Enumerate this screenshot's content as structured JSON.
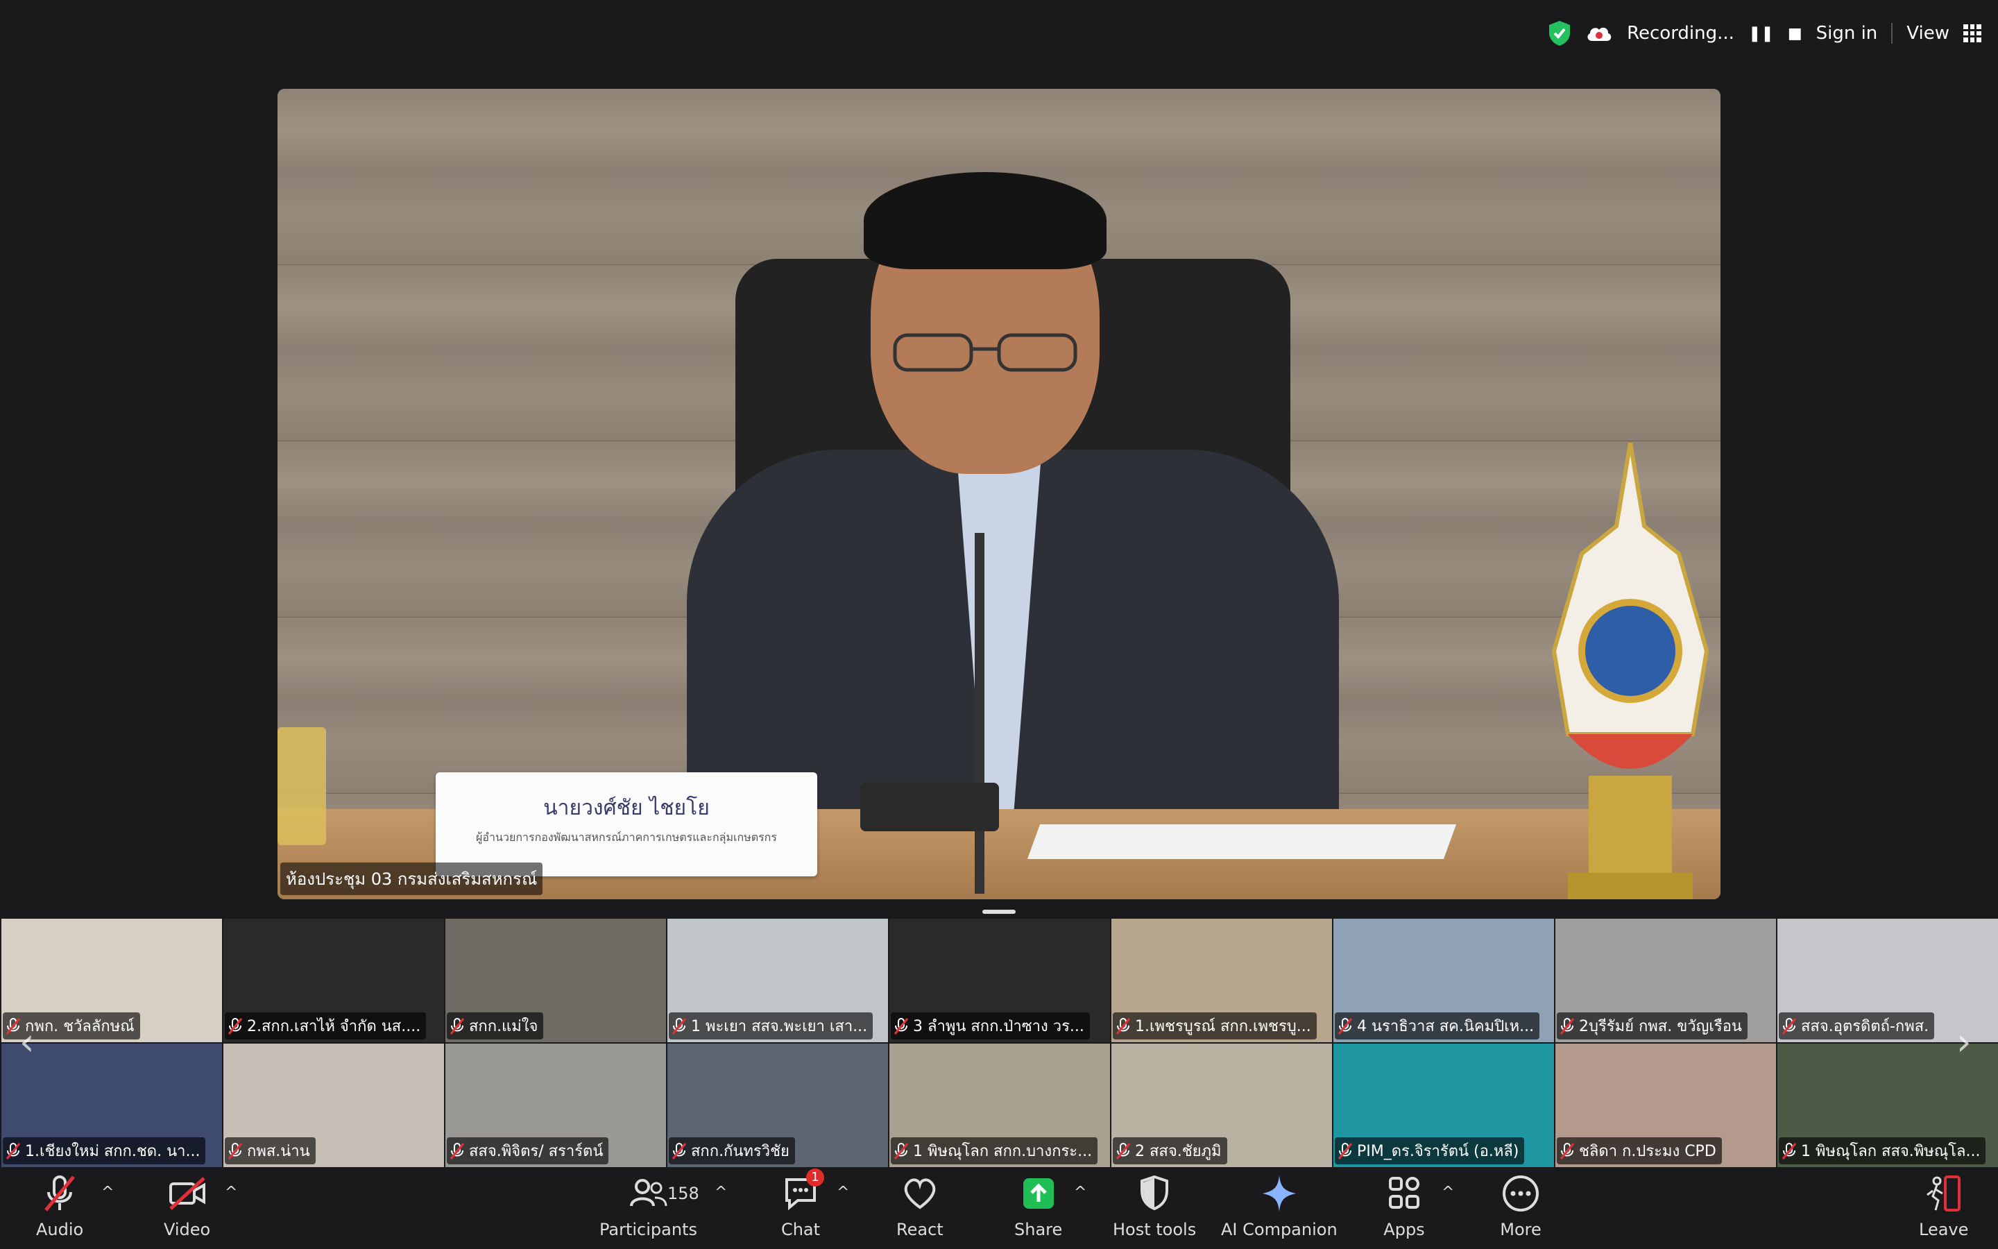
{
  "topbar": {
    "recording_label": "Recording...",
    "pause_glyph": "❚❚",
    "stop_glyph": "■",
    "sign_in": "Sign in",
    "view": "View"
  },
  "main_video": {
    "nameplate_name": "นายวงศ์ชัย ไชยโย",
    "nameplate_title": "ผู้อำนวยการกองพัฒนาสหกรณ์ภาคการเกษตรและกลุ่มเกษตรกร",
    "room_label": "ห้องประชุม 03 กรมส่งเสริมสหกรณ์"
  },
  "gallery": {
    "prev_glyph": "‹",
    "next_glyph": "›",
    "row1": [
      {
        "name": "กพก. ชวัลลักษณ์",
        "bg": "#d8cfc4"
      },
      {
        "name": "2.สกก.เสาไห้ จำกัด นส....",
        "bg": "#2b2b2b"
      },
      {
        "name": "สกก.แม่ใจ",
        "bg": "#6e6a64"
      },
      {
        "name": "1 พะเยา สสจ.พะเยา เสา...",
        "bg": "#bfc5c8"
      },
      {
        "name": "3 ลำพูน สกก.ป่าซาง วร...",
        "bg": "#2b2b2b"
      },
      {
        "name": "1.เพชรบูรณ์ สกก.เพชรบู...",
        "bg": "#b7a58d"
      },
      {
        "name": "4 นราธิวาส สค.นิคมปิเห...",
        "bg": "#8fa2b5"
      },
      {
        "name": "2บุรีรัมย์ กพส. ขวัญเรือน",
        "bg": "#a09f9d"
      },
      {
        "name": "สสจ.อุตรดิตถ์-กพส.",
        "bg": "#c4c6c9"
      }
    ],
    "row2": [
      {
        "name": "1.เชียงใหม่ สกก.ชด. นา...",
        "bg": "#3e4a6e"
      },
      {
        "name": "กพส.น่าน",
        "bg": "#c7bfb5"
      },
      {
        "name": "สสจ.พิจิตร/ สราร์ตน์",
        "bg": "#9a9894"
      },
      {
        "name": "สกก.กันทรวิชัย",
        "bg": "#5d6572"
      },
      {
        "name": "1 พิษณุโลก สกก.บางกระ...",
        "bg": "#a9a08f"
      },
      {
        "name": "2 สสจ.ชัยภูมิ",
        "bg": "#b9b1a2"
      },
      {
        "name": "PIM_ดร.จิรารัตน์ (อ.หลี)",
        "bg": "#1f97a3"
      },
      {
        "name": "ชลิดา ก.ประมง CPD",
        "bg": "#b39a8c"
      },
      {
        "name": "1 พิษณุโลก สสจ.พิษณุโล...",
        "bg": "#4d5a45"
      }
    ]
  },
  "toolbar": {
    "audio": "Audio",
    "video": "Video",
    "participants": "Participants",
    "participants_count": "158",
    "chat": "Chat",
    "chat_badge": "1",
    "react": "React",
    "share": "Share",
    "host_tools": "Host tools",
    "ai_companion": "AI Companion",
    "apps": "Apps",
    "more": "More",
    "leave": "Leave",
    "caret": "^"
  },
  "colors": {
    "background": "#1a1a1d",
    "share_green": "#1fbf55",
    "muted_red": "#e0303a",
    "badge_red": "#e02b2b",
    "security_green": "#23c160"
  },
  "icons": [
    "shield-check-icon",
    "cloud-record-icon",
    "grid-view-icon",
    "muted-mic-icon",
    "mic-off-icon",
    "video-off-icon",
    "participants-icon",
    "chat-icon",
    "heart-icon",
    "share-arrow-icon",
    "host-shield-icon",
    "sparkle-icon",
    "apps-icon",
    "more-dots-icon",
    "leave-door-icon"
  ]
}
